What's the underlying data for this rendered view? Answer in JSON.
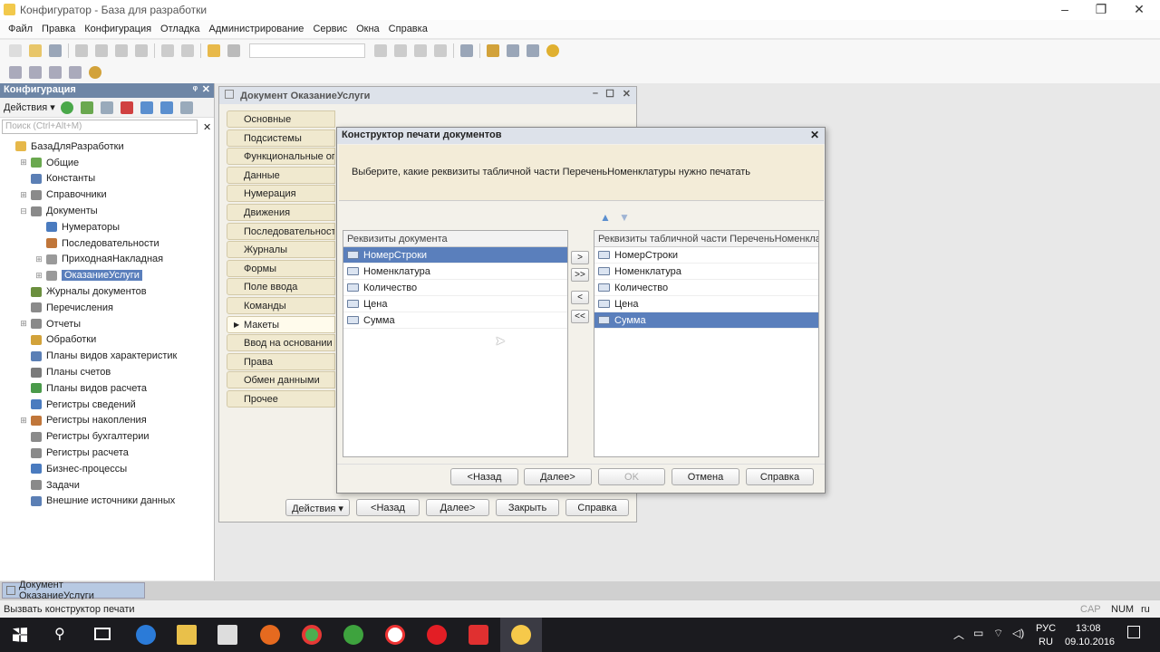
{
  "window": {
    "title": "Конфигуратор - База для разработки"
  },
  "menu": [
    "Файл",
    "Правка",
    "Конфигурация",
    "Отладка",
    "Администрирование",
    "Сервис",
    "Окна",
    "Справка"
  ],
  "left_panel": {
    "title": "Конфигурация",
    "actions_label": "Действия",
    "search_placeholder": "Поиск (Ctrl+Alt+M)",
    "tree": [
      {
        "label": "БазаДляРазработки",
        "exp": "",
        "color": "#e6b84a",
        "indent": 0
      },
      {
        "label": "Общие",
        "exp": "⊞",
        "color": "#6aa84f",
        "indent": 1
      },
      {
        "label": "Константы",
        "exp": "",
        "color": "#5b7fb5",
        "indent": 1
      },
      {
        "label": "Справочники",
        "exp": "⊞",
        "color": "#8a8a8a",
        "indent": 1
      },
      {
        "label": "Документы",
        "exp": "⊟",
        "color": "#8a8a8a",
        "indent": 1
      },
      {
        "label": "Нумераторы",
        "exp": "",
        "color": "#4a7bbf",
        "indent": 2
      },
      {
        "label": "Последовательности",
        "exp": "",
        "color": "#c0763a",
        "indent": 2
      },
      {
        "label": "ПриходнаяНакладная",
        "exp": "⊞",
        "color": "#9a9a9a",
        "indent": 2
      },
      {
        "label": "ОказаниеУслуги",
        "exp": "⊞",
        "color": "#9a9a9a",
        "indent": 2,
        "selected": true
      },
      {
        "label": "Журналы документов",
        "exp": "",
        "color": "#6b8f3e",
        "indent": 1
      },
      {
        "label": "Перечисления",
        "exp": "",
        "color": "#8a8a8a",
        "indent": 1
      },
      {
        "label": "Отчеты",
        "exp": "⊞",
        "color": "#8a8a8a",
        "indent": 1
      },
      {
        "label": "Обработки",
        "exp": "",
        "color": "#d2a23a",
        "indent": 1
      },
      {
        "label": "Планы видов характеристик",
        "exp": "",
        "color": "#5b7fb5",
        "indent": 1
      },
      {
        "label": "Планы счетов",
        "exp": "",
        "color": "#7a7a7a",
        "indent": 1
      },
      {
        "label": "Планы видов расчета",
        "exp": "",
        "color": "#4a9a4a",
        "indent": 1
      },
      {
        "label": "Регистры сведений",
        "exp": "",
        "color": "#4a7bbf",
        "indent": 1
      },
      {
        "label": "Регистры накопления",
        "exp": "⊞",
        "color": "#c0763a",
        "indent": 1
      },
      {
        "label": "Регистры бухгалтерии",
        "exp": "",
        "color": "#8a8a8a",
        "indent": 1
      },
      {
        "label": "Регистры расчета",
        "exp": "",
        "color": "#8a8a8a",
        "indent": 1
      },
      {
        "label": "Бизнес-процессы",
        "exp": "",
        "color": "#4a7bbf",
        "indent": 1
      },
      {
        "label": "Задачи",
        "exp": "",
        "color": "#8a8a8a",
        "indent": 1
      },
      {
        "label": "Внешние источники данных",
        "exp": "",
        "color": "#5b7fb5",
        "indent": 1
      }
    ]
  },
  "doc_window": {
    "title": "Документ ОказаниеУслуги",
    "sections": [
      "Основные",
      "Подсистемы",
      "Функциональные опции",
      "Данные",
      "Нумерация",
      "Движения",
      "Последовательности",
      "Журналы",
      "Формы",
      "Поле ввода",
      "Команды",
      "Макеты",
      "Ввод на основании",
      "Права",
      "Обмен данными",
      "Прочее"
    ],
    "active_section": "Макеты",
    "buttons": {
      "actions": "Действия",
      "back": "<Назад",
      "next": "Далее>",
      "close": "Закрыть",
      "help": "Справка"
    }
  },
  "dialog": {
    "title": "Конструктор печати документов",
    "instruction": "Выберите, какие реквизиты табличной части ПереченьНоменклатуры нужно печатать",
    "left_header": "Реквизиты документа",
    "left_items": [
      "НомерСтроки",
      "Номенклатура",
      "Количество",
      "Цена",
      "Сумма"
    ],
    "left_selected": "НомерСтроки",
    "right_header": "Реквизиты табличной части ПереченьНоменклатуры",
    "right_items": [
      "НомерСтроки",
      "Номенклатура",
      "Количество",
      "Цена",
      "Сумма"
    ],
    "right_selected": "Сумма",
    "arrows": [
      ">",
      ">>",
      "<",
      "<<"
    ],
    "buttons": {
      "back": "<Назад",
      "next": "Далее>",
      "ok": "OK",
      "cancel": "Отмена",
      "help": "Справка"
    }
  },
  "taskstrip": {
    "item": "Документ ОказаниеУслуги"
  },
  "status": {
    "text": "Вызвать конструктор печати",
    "cap": "CAP",
    "num": "NUM",
    "lang": "ru"
  },
  "taskbar": {
    "lang": "РУС",
    "region": "RU",
    "time": "13:08",
    "date": "09.10.2016"
  }
}
